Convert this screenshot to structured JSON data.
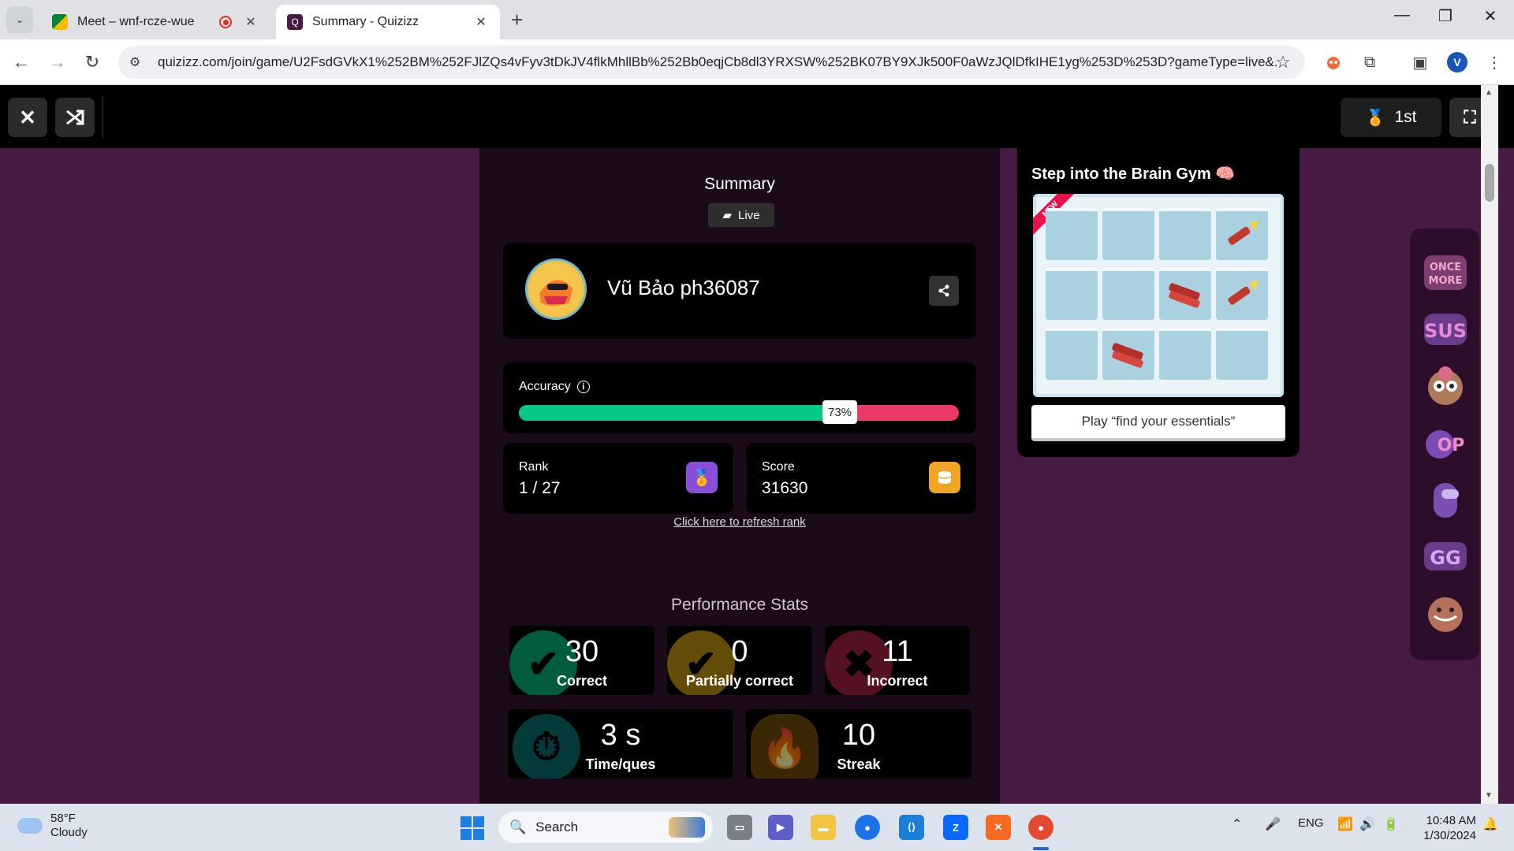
{
  "browser": {
    "tabs": [
      {
        "title": "Meet – wnf-rcze-wue",
        "active": false,
        "recording": true
      },
      {
        "title": "Summary - Quizizz",
        "active": true,
        "recording": false
      }
    ],
    "url": "quizizz.com/join/game/U2FsdGVkX1%252BM%252FJlZQs4vFyv3tDkJV4flkMhllBb%252Bb0eqjCb8dl3YRXSW%252BK07BY9XJk500F0aWzJQlDfkIHE1yg%253D%253D?gameType=live&...",
    "profile_initial": "V"
  },
  "header": {
    "rank_badge": "1st"
  },
  "summary": {
    "title": "Summary",
    "mode_label": "Live",
    "player_name": "Vũ Bảo ph36087",
    "accuracy_label": "Accuracy",
    "accuracy_value": "73%",
    "accuracy_fraction": 0.73,
    "rank_label": "Rank",
    "rank_value": "1 / 27",
    "score_label": "Score",
    "score_value": "31630",
    "refresh_link": "Click here to refresh rank"
  },
  "performance": {
    "title": "Performance Stats",
    "correct": {
      "value": "30",
      "label": "Correct"
    },
    "partial": {
      "value": "0",
      "label": "Partially correct"
    },
    "incorrect": {
      "value": "11",
      "label": "Incorrect"
    },
    "time": {
      "value": "3 s",
      "label": "Time/ques"
    },
    "streak": {
      "value": "10",
      "label": "Streak"
    }
  },
  "brain_gym": {
    "title": "Step into the Brain Gym 🧠",
    "new_tag": "NEW",
    "play_button": "Play “find your essentials”"
  },
  "stickers": [
    "once-more-sticker",
    "sus-sticker",
    "owl-sticker",
    "op-sticker",
    "among-us-sticker",
    "gg-sticker",
    "face-sticker"
  ],
  "stickers_text": {
    "once_more": "ONCE MORE",
    "sus": "SUS",
    "op": "OP",
    "gg": "GG"
  },
  "taskbar": {
    "weather_temp": "58°F",
    "weather_desc": "Cloudy",
    "search_label": "Search",
    "language": "ENG",
    "time": "10:48 AM",
    "date": "1/30/2024"
  },
  "colors": {
    "page_bg": "#461a42",
    "correct": "#00c985",
    "incorrect": "#ec3a66",
    "rank_icon": "#8a4fd8",
    "score_icon": "#f0a524"
  }
}
